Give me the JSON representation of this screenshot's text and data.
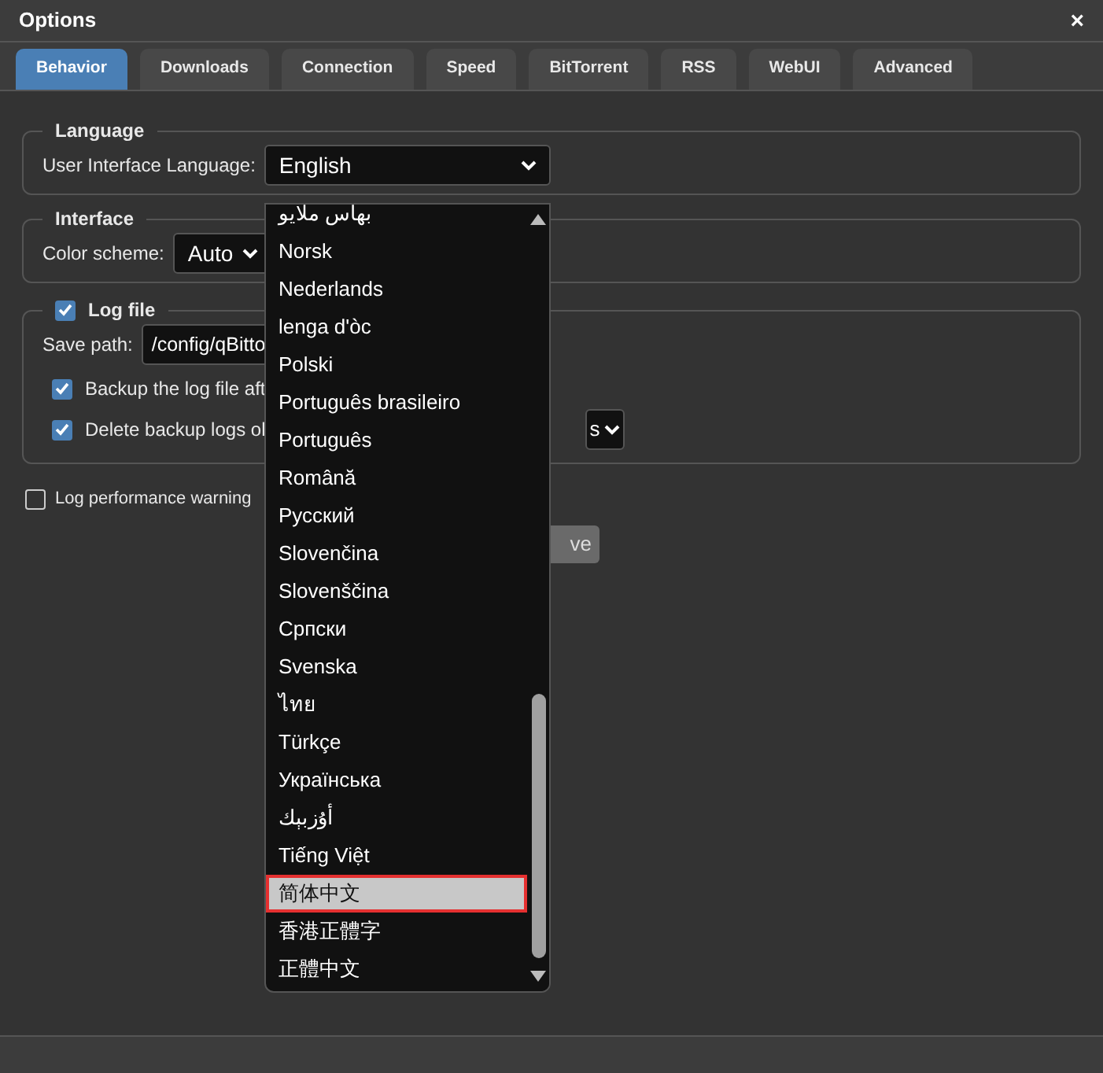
{
  "window": {
    "title": "Options",
    "close": "×"
  },
  "tabs": [
    {
      "label": "Behavior",
      "selected": true
    },
    {
      "label": "Downloads",
      "selected": false
    },
    {
      "label": "Connection",
      "selected": false
    },
    {
      "label": "Speed",
      "selected": false
    },
    {
      "label": "BitTorrent",
      "selected": false
    },
    {
      "label": "RSS",
      "selected": false
    },
    {
      "label": "WebUI",
      "selected": false
    },
    {
      "label": "Advanced",
      "selected": false
    }
  ],
  "language": {
    "legend": "Language",
    "label": "User Interface Language:",
    "value": "English"
  },
  "interface": {
    "legend": "Interface",
    "label": "Color scheme:",
    "value": "Auto"
  },
  "log_file": {
    "legend": "Log file",
    "checked": true,
    "save_path_label": "Save path:",
    "save_path": "/config/qBitto",
    "options": [
      {
        "label": "Backup the log file aft",
        "checked": true
      },
      {
        "label": "Delete backup logs ol",
        "checked": true,
        "select_value": "s"
      }
    ]
  },
  "log_performance": {
    "label": "Log performance warning",
    "checked": false
  },
  "save_button": "ve",
  "dropdown": {
    "items": [
      {
        "label": "بهاس ملايو",
        "selected": false
      },
      {
        "label": "Norsk",
        "selected": false
      },
      {
        "label": "Nederlands",
        "selected": false
      },
      {
        "label": "lenga d'òc",
        "selected": false
      },
      {
        "label": "Polski",
        "selected": false
      },
      {
        "label": "Português brasileiro",
        "selected": false
      },
      {
        "label": "Português",
        "selected": false
      },
      {
        "label": "Română",
        "selected": false
      },
      {
        "label": "Русский",
        "selected": false
      },
      {
        "label": "Slovenčina",
        "selected": false
      },
      {
        "label": "Slovenščina",
        "selected": false
      },
      {
        "label": "Српски",
        "selected": false
      },
      {
        "label": "Svenska",
        "selected": false
      },
      {
        "label": "ไทย",
        "selected": false
      },
      {
        "label": "Türkçe",
        "selected": false
      },
      {
        "label": "Українська",
        "selected": false
      },
      {
        "label": "أۇزبېك",
        "selected": false
      },
      {
        "label": "Tiếng Việt",
        "selected": false
      },
      {
        "label": "简体中文",
        "selected": true
      },
      {
        "label": "香港正體字",
        "selected": false
      },
      {
        "label": "正體中文",
        "selected": false
      }
    ]
  }
}
